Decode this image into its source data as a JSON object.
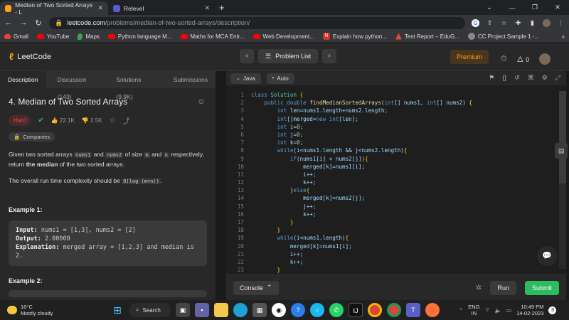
{
  "browser": {
    "tabs": [
      {
        "title": "Median of Two Sorted Arrays - L",
        "favicon_color": "#ffa116"
      },
      {
        "title": "Relevel",
        "favicon_color": "#5b5bd6"
      }
    ],
    "url_domain": "leetcode.com",
    "url_path": "/problems/median-of-two-sorted-arrays/description/",
    "bookmarks": [
      {
        "label": "Gmail",
        "color": "#ea4335"
      },
      {
        "label": "YouTube",
        "color": "#ff0000"
      },
      {
        "label": "Maps",
        "color": "#34a853"
      },
      {
        "label": "Python language M...",
        "color": "#ff0000"
      },
      {
        "label": "Maths for MCA Entr...",
        "color": "#ff0000"
      },
      {
        "label": "Web Development...",
        "color": "#ff0000"
      },
      {
        "label": "Explain how python...",
        "color": "#d93025"
      },
      {
        "label": "Test Report – EduG...",
        "color": "#e8453c"
      },
      {
        "label": "CC  Project Sample 1 -...",
        "color": "#aaaaaa"
      }
    ]
  },
  "header": {
    "logo_text": "LeetCode",
    "problem_list": "Problem List",
    "premium": "Premium",
    "fire_count": "0"
  },
  "left": {
    "tabs": [
      "Description",
      "Discussion (143)",
      "Solutions (9.9K)",
      "Submissions"
    ],
    "title": "4. Median of Two Sorted Arrays",
    "difficulty": "Hard",
    "likes": "22.1K",
    "dislikes": "2.5K",
    "companies": "Companies",
    "p1_a": "Given two sorted arrays ",
    "p1_code1": "nums1",
    "p1_b": " and ",
    "p1_code2": "nums2",
    "p1_c": " of size ",
    "p1_code3": "m",
    "p1_d": " and ",
    "p1_code4": "n",
    "p1_e": " respectively, return ",
    "p1_bold": "the median",
    "p1_f": " of the two sorted arrays.",
    "p2_a": "The overall run time complexity should be ",
    "p2_code": "O(log (m+n))",
    "p2_b": ".",
    "example1_title": "Example 1:",
    "ex1_input_label": "Input:",
    "ex1_input": " nums1 = [1,3], nums2 = [2]",
    "ex1_output_label": "Output:",
    "ex1_output": " 2.00000",
    "ex1_expl_label": "Explanation:",
    "ex1_expl": " merged array = [1,2,3] and median is 2.",
    "example2_title": "Example 2:"
  },
  "editor": {
    "language": "Java",
    "mode": "Auto",
    "line_numbers": [
      "1",
      "2",
      "3",
      "4",
      "5",
      "6",
      "7",
      "8",
      "9",
      "10",
      "11",
      "12",
      "13",
      "14",
      "15",
      "16",
      "17",
      "18",
      "19",
      "20",
      "21",
      "22",
      "23"
    ],
    "console_label": "Console",
    "run_label": "Run",
    "submit_label": "Submit"
  },
  "taskbar": {
    "temp": "16°C",
    "weather": "Mostly cloudy",
    "search": "Search",
    "lang1": "ENG",
    "lang2": "IN",
    "time": "10:49 PM",
    "date": "14-02-2023",
    "badge": "3"
  }
}
